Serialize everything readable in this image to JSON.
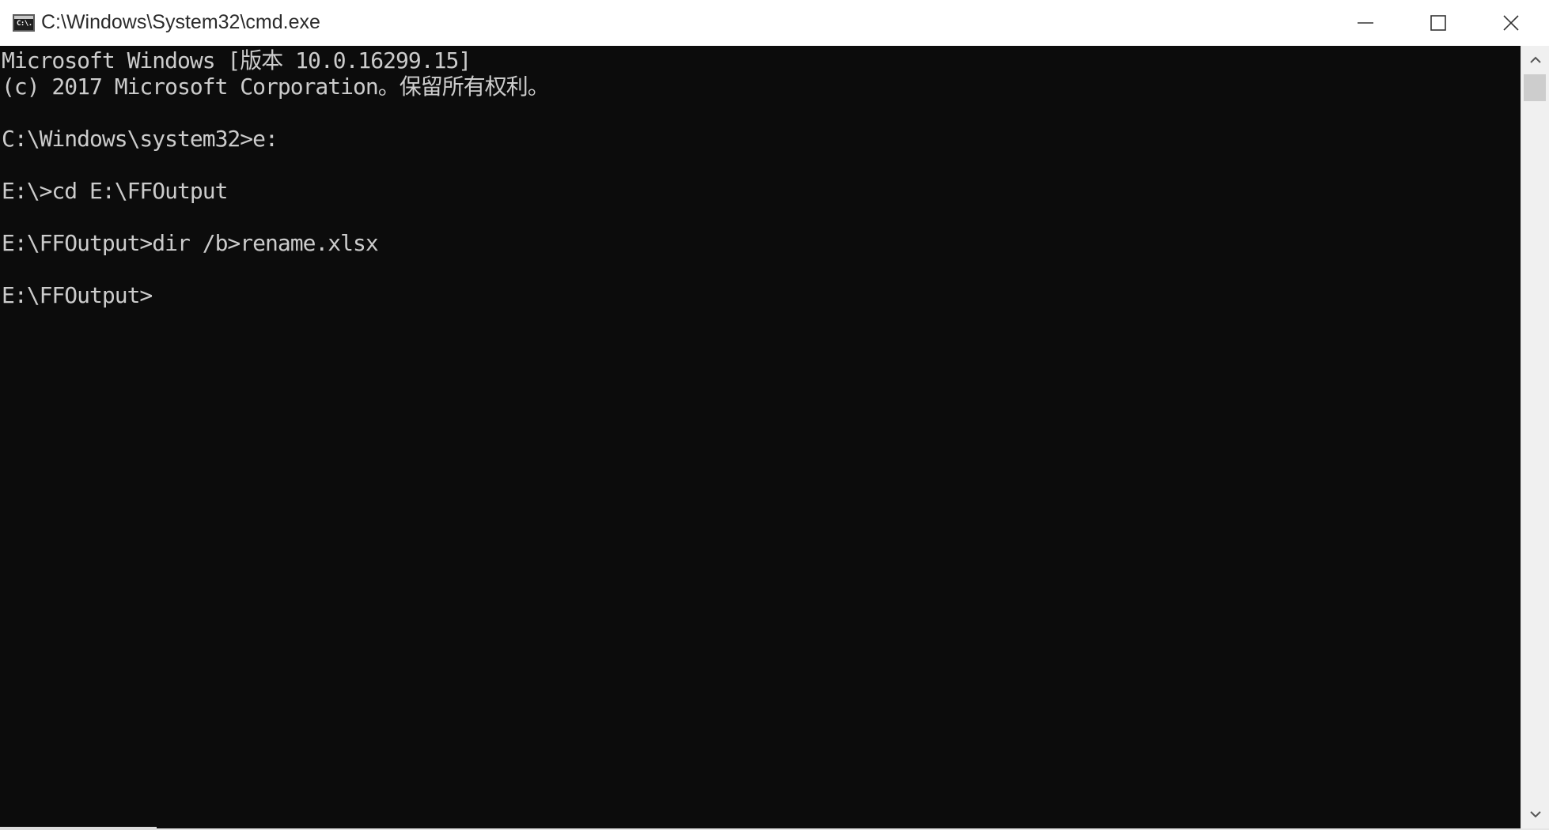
{
  "window": {
    "title": "C:\\Windows\\System32\\cmd.exe",
    "icon": "cmd-icon",
    "icon_label": "C:\\."
  },
  "caption_buttons": {
    "minimize": "minimize-icon",
    "maximize": "maximize-icon",
    "close": "close-icon"
  },
  "console": {
    "background": "#0c0c0c",
    "foreground": "#cccccc",
    "lines": [
      "Microsoft Windows [版本 10.0.16299.15]",
      "(c) 2017 Microsoft Corporation。保留所有权利。",
      "",
      "C:\\Windows\\system32>e:",
      "",
      "E:\\>cd E:\\FFOutput",
      "",
      "E:\\FFOutput>dir /b>rename.xlsx",
      "",
      "E:\\FFOutput>"
    ]
  },
  "scrollbar": {
    "up": "chevron-up-icon",
    "down": "chevron-down-icon"
  }
}
